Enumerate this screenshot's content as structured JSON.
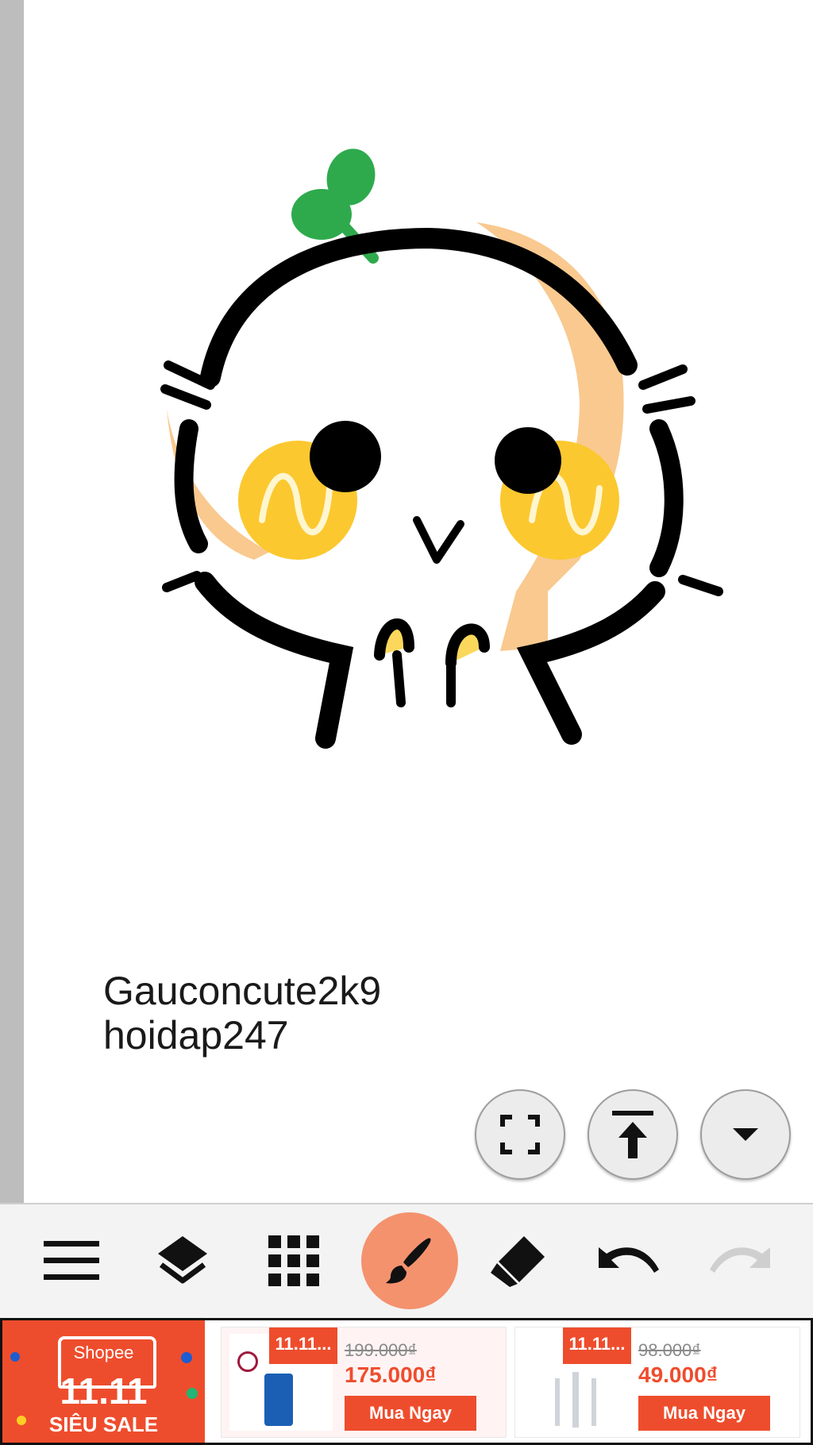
{
  "canvas": {
    "signature_line1": "Gauconcute2k9",
    "signature_line2": "hoidap247"
  },
  "float_buttons": [
    {
      "icon": "fullscreen-icon"
    },
    {
      "icon": "scroll-top-icon"
    },
    {
      "icon": "dropdown-icon"
    }
  ],
  "toolbar": {
    "tools": [
      "menu-icon",
      "layers-icon",
      "grid-icon",
      "brush-icon",
      "eraser-icon",
      "undo-icon",
      "redo-icon"
    ],
    "active_tool": "brush-icon",
    "active_color": "#f4926e"
  },
  "ad": {
    "banner": {
      "brand": "Shopee",
      "sale_date": "11.11",
      "sale_label": "SIÊU SALE"
    },
    "products": [
      {
        "badge": "11.11...",
        "old_price": "199.000₫",
        "new_price": "175.000₫",
        "button": "Mua Ngay"
      },
      {
        "badge": "11.11...",
        "old_price": "98.000₫",
        "new_price": "49.000₫",
        "button": "Mua Ngay"
      }
    ],
    "brand_color": "#ee4d2d"
  }
}
